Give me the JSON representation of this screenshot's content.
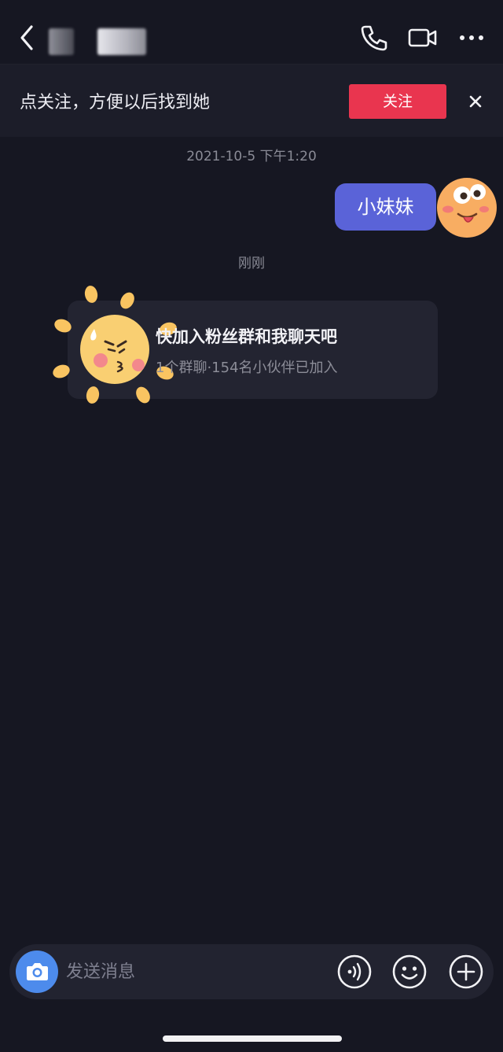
{
  "header": {
    "back_icon": "chevron-left-icon",
    "contact_name_blurred": true,
    "actions": [
      {
        "icon": "phone-icon"
      },
      {
        "icon": "video-icon"
      },
      {
        "icon": "more-icon"
      }
    ]
  },
  "follow_bar": {
    "text": "点关注，方便以后找到她",
    "button_label": "关注",
    "close_icon": "close-icon",
    "button_color": "#e9354f"
  },
  "messages": {
    "timestamp_1": "2021-10-5 下午1:20",
    "my_message": "小妹妹",
    "timestamp_2": "刚刚",
    "group_card": {
      "title": "快加入粉丝群和我聊天吧",
      "subtitle": "1个群聊·154名小伙伴已加入"
    }
  },
  "input_bar": {
    "placeholder": "发送消息",
    "camera_icon": "camera-icon",
    "voice_icon": "voice-icon",
    "emoji_icon": "emoji-icon",
    "plus_icon": "plus-icon",
    "accent": "#4d8bec"
  },
  "colors": {
    "background": "#161722",
    "bubble": "#5a63d8"
  }
}
